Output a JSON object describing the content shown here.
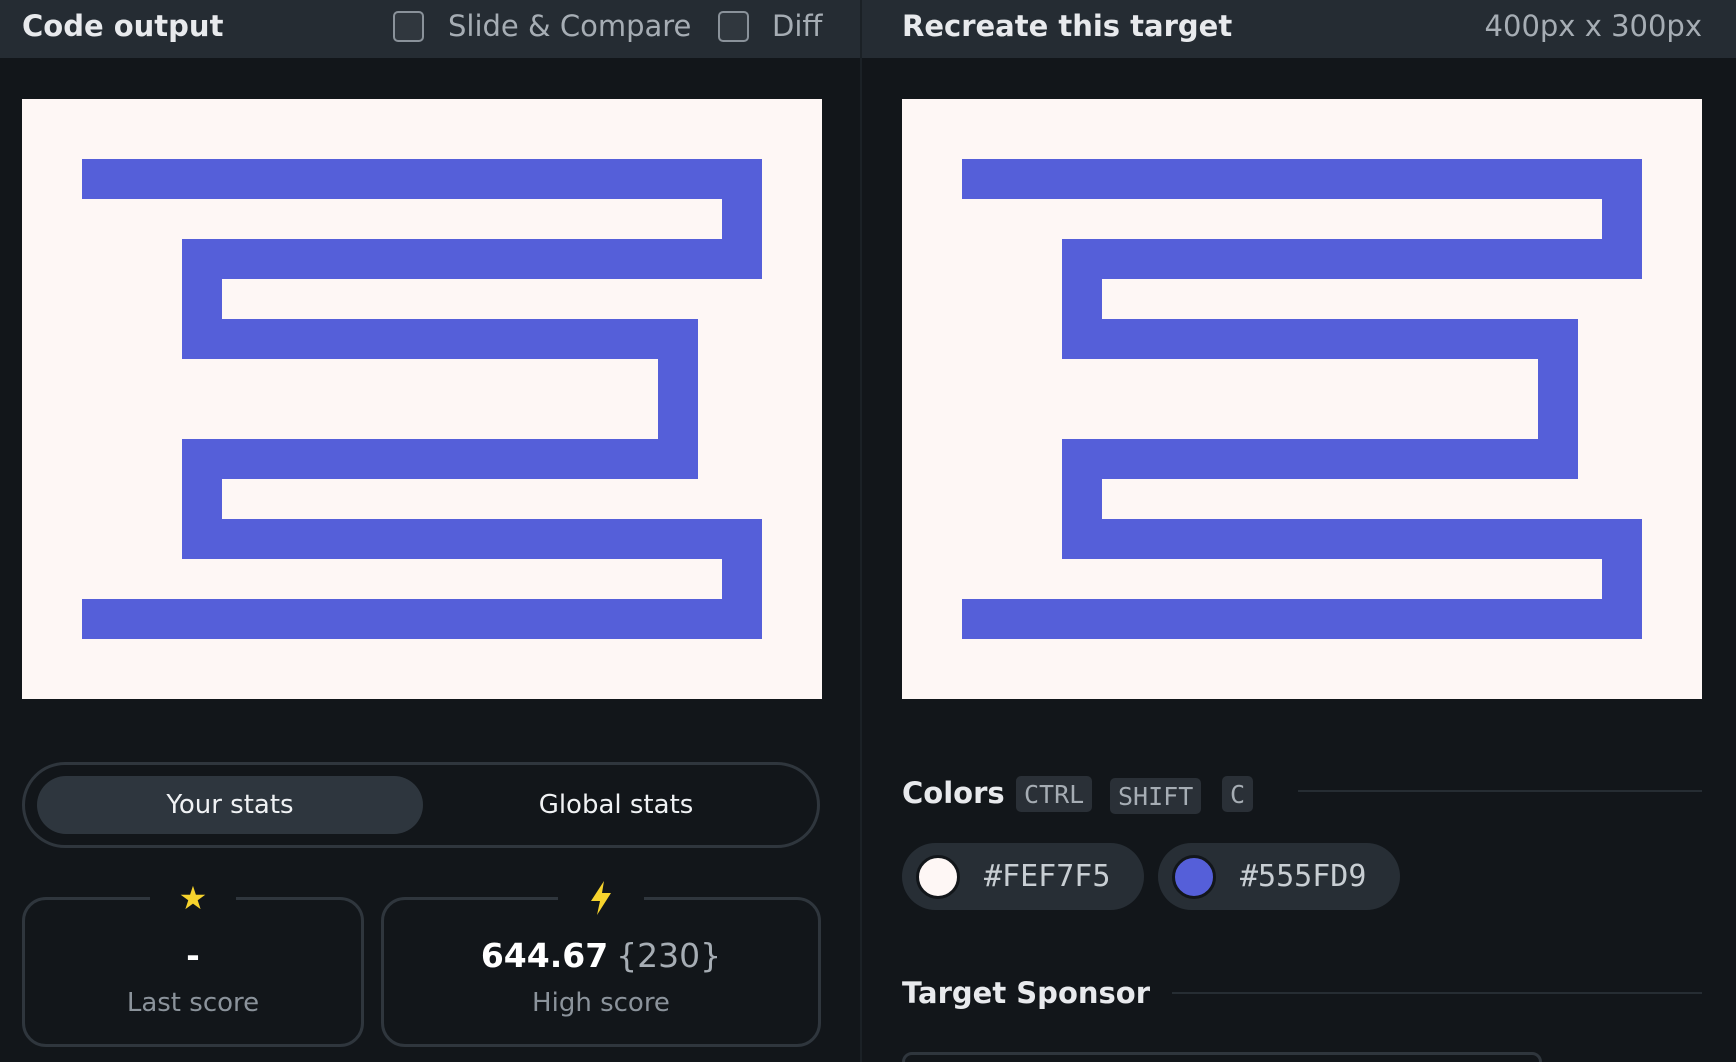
{
  "header": {
    "left_title": "Code output",
    "slide_compare_label": "Slide & Compare",
    "diff_label": "Diff",
    "right_title": "Recreate this target",
    "dimensions": "400px x 300px"
  },
  "canvas": {
    "background_color": "#FEF7F5",
    "shape_color": "#555FD9"
  },
  "stats_toggle": {
    "your_stats_label": "Your stats",
    "global_stats_label": "Global stats"
  },
  "stats": {
    "last_score_value": "-",
    "last_score_label": "Last score",
    "high_score_value": "644.67",
    "high_score_extra": "{230}",
    "high_score_label": "High score"
  },
  "colors_section": {
    "title": "Colors",
    "shortcut_keys": [
      "CTRL",
      "SHIFT",
      "C"
    ],
    "swatches": [
      {
        "hex": "#FEF7F5"
      },
      {
        "hex": "#555FD9"
      }
    ]
  },
  "sponsor_section": {
    "title": "Target Sponsor"
  }
}
